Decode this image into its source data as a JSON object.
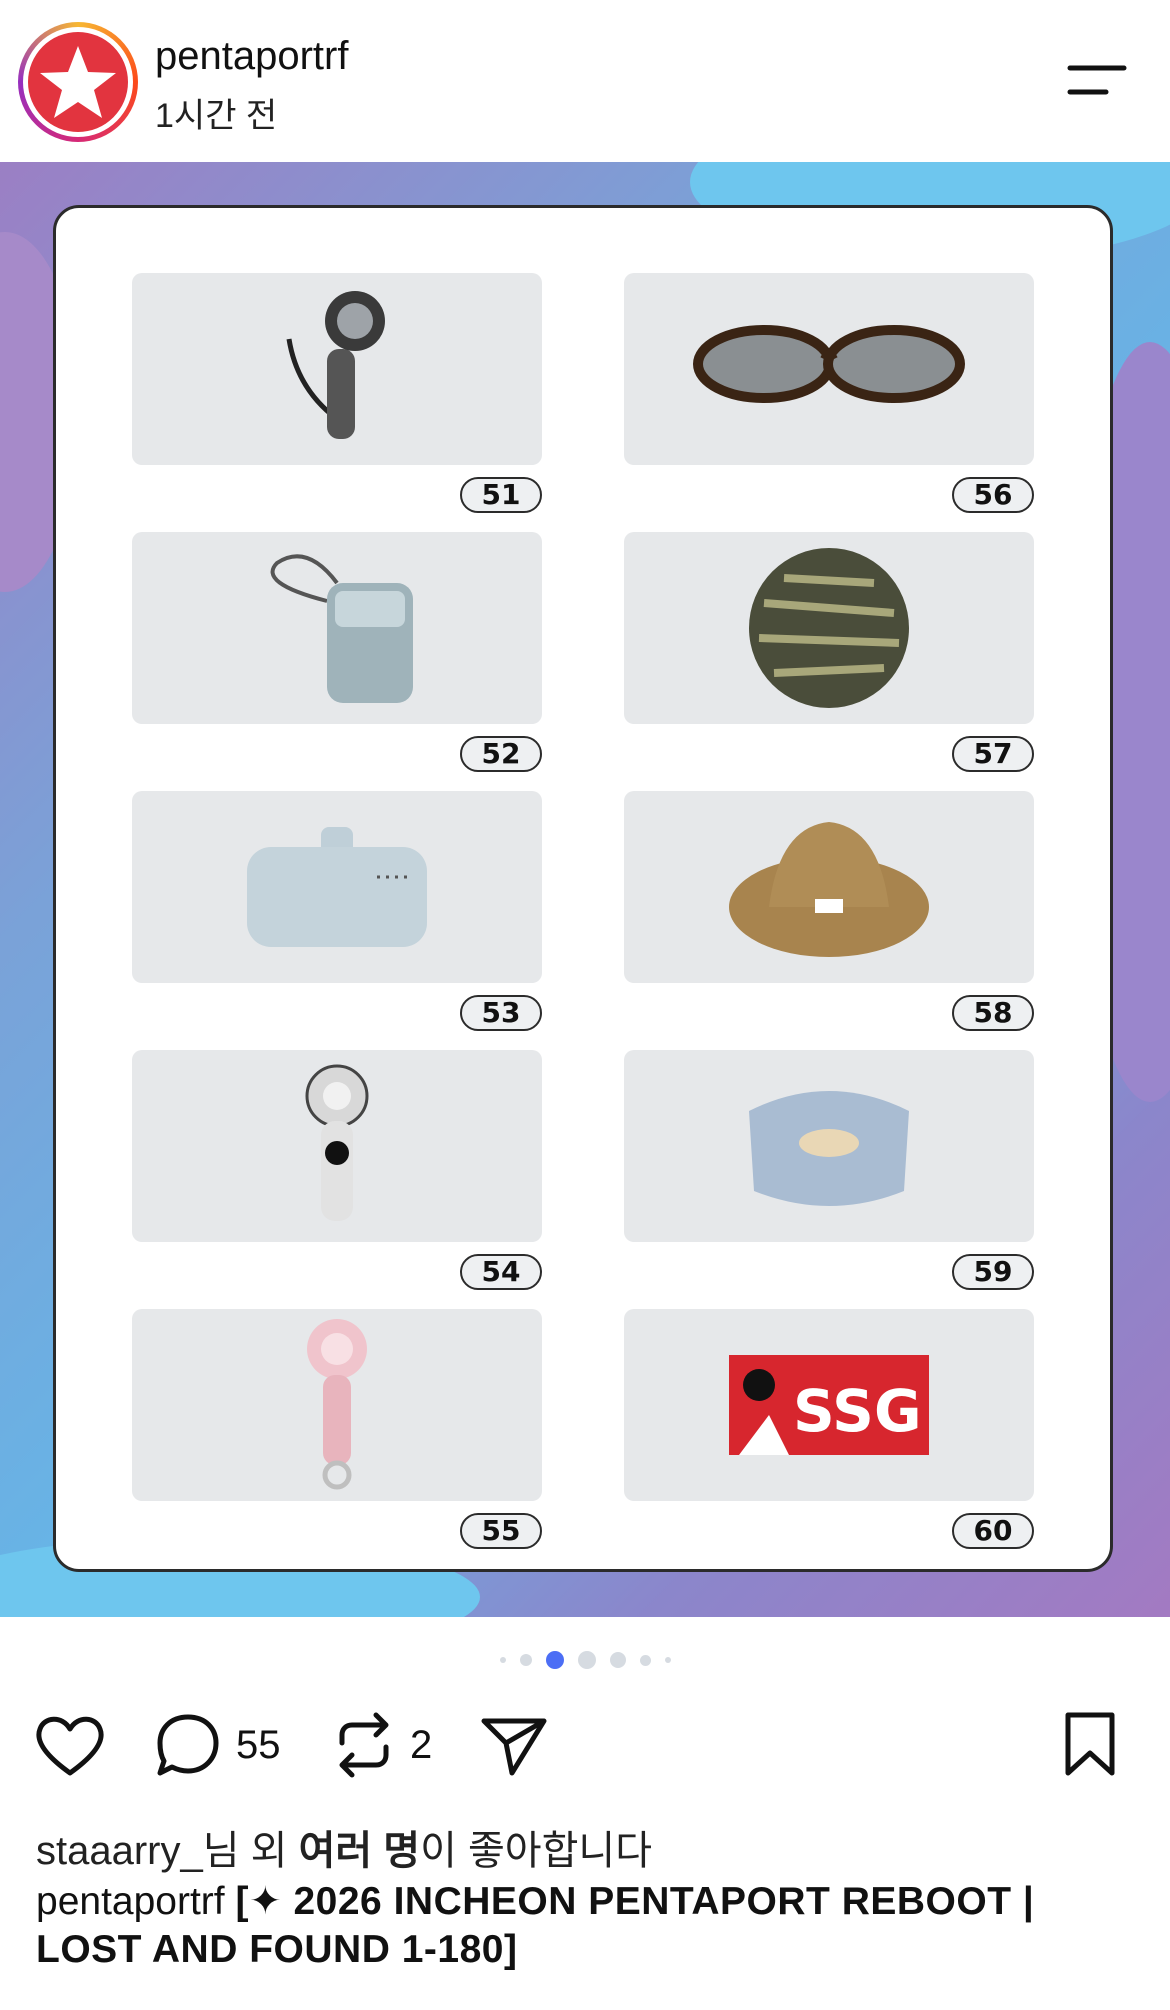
{
  "header": {
    "username": "pentaportrf",
    "timestamp": "1시간 전"
  },
  "post": {
    "items": [
      {
        "number": "51",
        "item": "handheld fan (grey)"
      },
      {
        "number": "56",
        "item": "tortoiseshell glasses"
      },
      {
        "number": "52",
        "item": "power bank with strap"
      },
      {
        "number": "57",
        "item": "camo bucket hat"
      },
      {
        "number": "53",
        "item": "power bank"
      },
      {
        "number": "58",
        "item": "brown bucket hat"
      },
      {
        "number": "54",
        "item": "handheld fan (white)"
      },
      {
        "number": "59",
        "item": "light blue pouch"
      },
      {
        "number": "55",
        "item": "pink handheld fan"
      },
      {
        "number": "60",
        "item": "SSG towel"
      }
    ],
    "towel_text": "SSG",
    "carousel": {
      "total": 7,
      "active_index": 2
    }
  },
  "actions": {
    "comments_count": "55",
    "reposts_count": "2"
  },
  "likes": {
    "user": "staaarry_",
    "text_part1": "님 외 ",
    "text_bold": "여러 명",
    "text_part2": "이 좋아합니다"
  },
  "caption": {
    "username": "pentaportrf",
    "text": "[✦ 2026 INCHEON PENTAPORT REBOOT | LOST AND FOUND 1-180]"
  },
  "colors": {
    "accent_dot": "#4c6ef5",
    "brand_red": "#e2343f"
  }
}
